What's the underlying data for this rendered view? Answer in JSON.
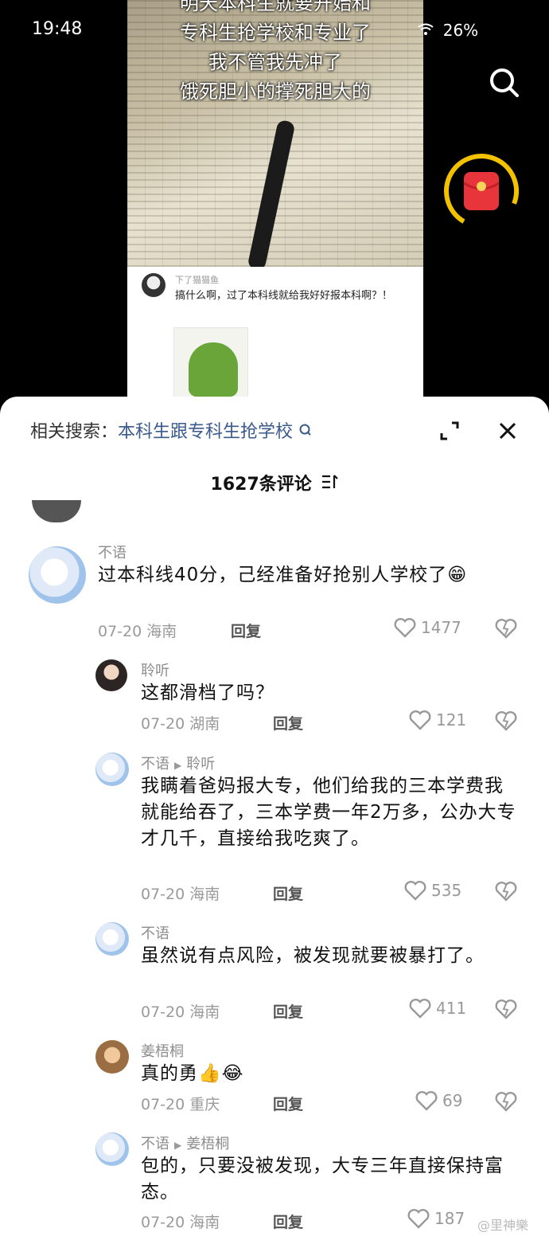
{
  "status": {
    "time": "19:48",
    "battery": "26%"
  },
  "video": {
    "caption_lines": [
      "明天本科生就要开始和",
      "专科生抢学校和专业了",
      "我不管我先冲了",
      "饿死胆小的撑死胆大的"
    ],
    "post": {
      "user": "下了猫猫鱼",
      "text": "搞什么啊，过了本科线就给我好好报本科啊？！"
    }
  },
  "sheet": {
    "related_label": "相关搜索：",
    "related_query": "本科生跟专科生抢学校",
    "comment_count_title": "1627条评论",
    "comments": [
      {
        "user": "不语",
        "reply_to": "",
        "text": "过本科线40分，己经准备好抢别人学校了😁",
        "date": "07-20",
        "region": "海南",
        "reply_label": "回复",
        "likes": "1477"
      },
      {
        "user": "聆听",
        "reply_to": "",
        "text": "这都滑档了吗？",
        "date": "07-20",
        "region": "湖南",
        "reply_label": "回复",
        "likes": "121"
      },
      {
        "user": "不语",
        "reply_to": "聆听",
        "text": "我瞒着爸妈报大专，他们给我的三本学费我就能给吞了，三本学费一年2万多，公办大专才几千，直接给我吃爽了。",
        "date": "07-20",
        "region": "海南",
        "reply_label": "回复",
        "likes": "535"
      },
      {
        "user": "不语",
        "reply_to": "",
        "text": "虽然说有点风险，被发现就要被暴打了。",
        "date": "07-20",
        "region": "海南",
        "reply_label": "回复",
        "likes": "411"
      },
      {
        "user": "姜梧桐",
        "reply_to": "",
        "text": "真的勇👍😂",
        "date": "07-20",
        "region": "重庆",
        "reply_label": "回复",
        "likes": "69"
      },
      {
        "user": "不语",
        "reply_to": "姜梧桐",
        "text": "包的，只要没被发现，大专三年直接保持富态。",
        "date": "07-20",
        "region": "海南",
        "reply_label": "回复",
        "likes": "187"
      }
    ]
  },
  "watermark": "@里神樂"
}
